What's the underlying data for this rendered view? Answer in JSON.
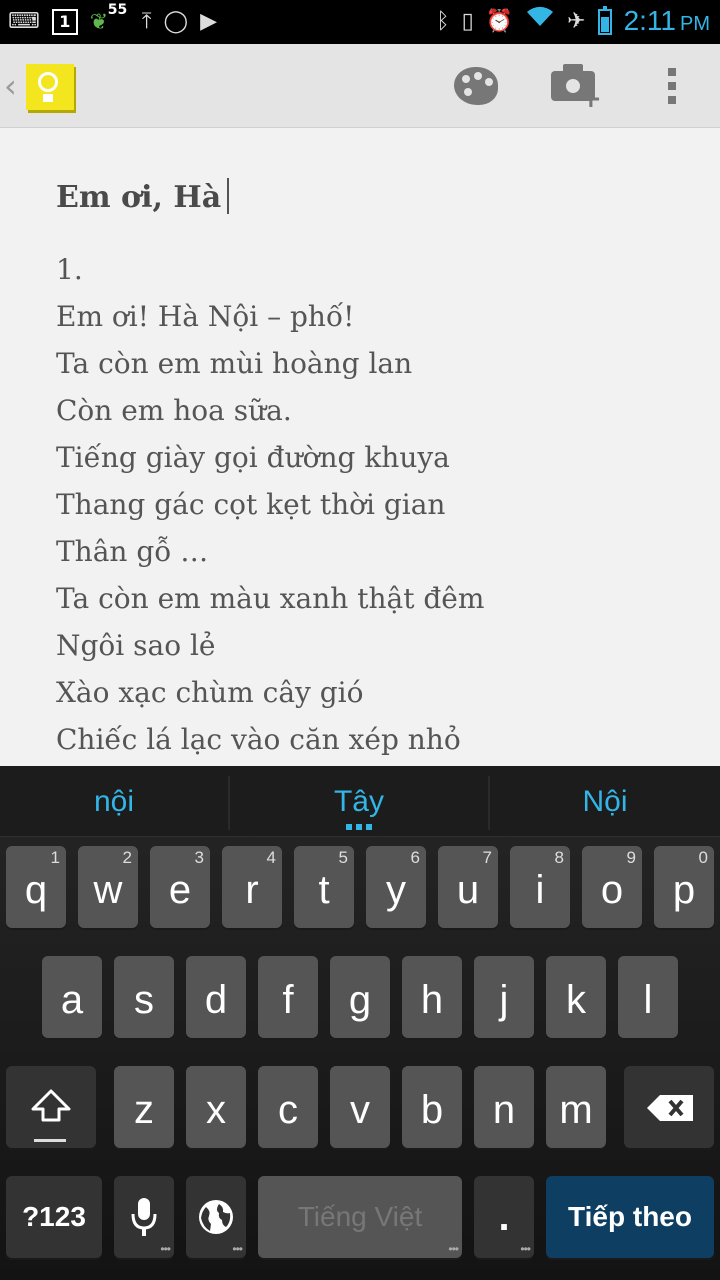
{
  "status_bar": {
    "notification_count": "55",
    "calendar_day": "1",
    "time": "2:11",
    "ampm": "PM"
  },
  "action_bar": {
    "icons": [
      "back-chevron-icon",
      "keep-app-icon",
      "palette-icon",
      "camera-add-icon",
      "overflow-menu-icon"
    ]
  },
  "note": {
    "title": "Em ơi, Hà",
    "lines": [
      "1.",
      "Em ơi! Hà Nội – phố!",
      "Ta còn em mùi hoàng lan",
      "Còn em hoa sữa.",
      "Tiếng giày gọi đường khuya",
      "Thang gác cọt kẹt thời gian",
      "Thân gỗ …",
      "Ta còn em màu xanh thật đêm",
      "Ngôi sao lẻ",
      "Xào xạc chùm cây gió",
      "Chiếc lá lạc vào căn xép nhỏ"
    ]
  },
  "keyboard": {
    "suggestions": [
      "nội",
      "Tây",
      "Nội"
    ],
    "row1": [
      {
        "label": "q",
        "hint": "1"
      },
      {
        "label": "w",
        "hint": "2"
      },
      {
        "label": "e",
        "hint": "3"
      },
      {
        "label": "r",
        "hint": "4"
      },
      {
        "label": "t",
        "hint": "5"
      },
      {
        "label": "y",
        "hint": "6"
      },
      {
        "label": "u",
        "hint": "7"
      },
      {
        "label": "i",
        "hint": "8"
      },
      {
        "label": "o",
        "hint": "9"
      },
      {
        "label": "p",
        "hint": "0"
      }
    ],
    "row2": [
      "a",
      "s",
      "d",
      "f",
      "g",
      "h",
      "j",
      "k",
      "l"
    ],
    "row3": [
      "z",
      "x",
      "c",
      "v",
      "b",
      "n",
      "m"
    ],
    "symbols_label": "?123",
    "space_label": "Tiếng Việt",
    "period_label": ".",
    "action_label": "Tiếp theo",
    "accent_color": "#33b5e5"
  }
}
